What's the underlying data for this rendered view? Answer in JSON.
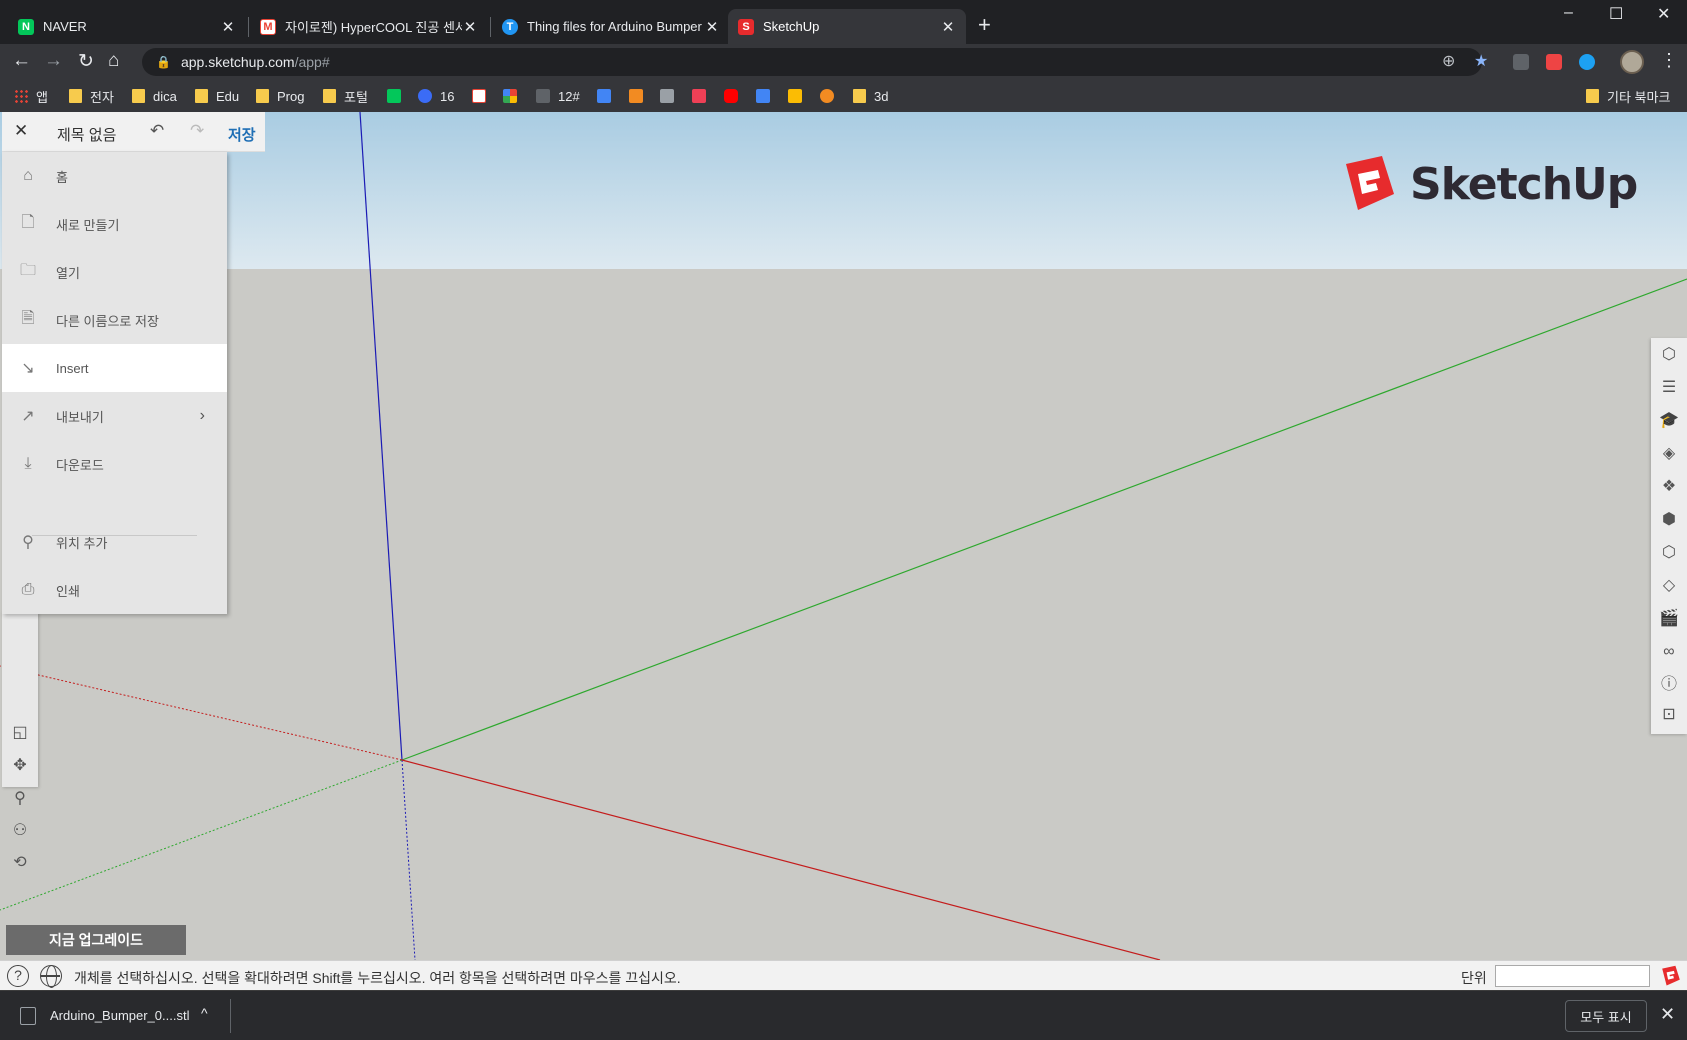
{
  "browser": {
    "tabs": [
      {
        "title": "NAVER",
        "icon": "naver-icon",
        "color": "#03c75a"
      },
      {
        "title": "자이로젠) HyperCOOL 진공 센서",
        "icon": "gmail-icon",
        "color": "#ea4335"
      },
      {
        "title": "Thing files for Arduino Bumper",
        "icon": "thingiverse-icon",
        "color": "#2196f3"
      },
      {
        "title": "SketchUp",
        "icon": "sketchup-icon",
        "color": "#e72b2d"
      }
    ],
    "new_tab": "+",
    "window_controls": {
      "minimize": "–",
      "maximize": "☐",
      "close": "✕"
    },
    "url": {
      "host": "app.sketchup.com",
      "path": "/app#"
    },
    "bookmarks": [
      {
        "label": "앱",
        "type": "apps"
      },
      {
        "label": "전자",
        "type": "folder"
      },
      {
        "label": "dica",
        "type": "folder"
      },
      {
        "label": "Edu",
        "type": "folder"
      },
      {
        "label": "Prog",
        "type": "folder"
      },
      {
        "label": "포털",
        "type": "folder"
      },
      {
        "label": "16",
        "type": "site"
      },
      {
        "label": "12#",
        "type": "site"
      },
      {
        "label": "3d",
        "type": "folder"
      }
    ],
    "other_bookmarks": "기타 북마크"
  },
  "app": {
    "header": {
      "close": "✕",
      "title": "제목 없음",
      "undo": "↶",
      "redo": "↷",
      "save": "저장"
    },
    "menu": {
      "items": [
        {
          "label": "홈",
          "icon": "home-icon"
        },
        {
          "label": "새로 만들기",
          "icon": "new-file-icon"
        },
        {
          "label": "열기",
          "icon": "folder-icon"
        },
        {
          "label": "다른 이름으로 저장",
          "icon": "save-as-icon"
        },
        {
          "label": "Insert",
          "icon": "insert-icon"
        },
        {
          "label": "내보내기",
          "icon": "export-icon"
        },
        {
          "label": "다운로드",
          "icon": "download-icon"
        },
        {
          "label": "위치 추가",
          "icon": "location-pin-icon"
        },
        {
          "label": "인쇄",
          "icon": "printer-icon"
        }
      ],
      "highlighted": "Insert"
    },
    "logo_text": "SketchUp",
    "upgrade_button": "지금 업그레이드",
    "status": {
      "message": "개체를 선택하십시오. 선택을 확대하려면 Shift를 누르십시오. 여러 항목을 선택하려면 마우스를 끄십시오.",
      "units_label": "단위",
      "units_value": ""
    },
    "colors": {
      "sky": "#b5d3e6",
      "ground": "#cacac6",
      "axis_blue": "#1b1bb5",
      "axis_green": "#2ea82e",
      "axis_red": "#c41c1c",
      "brand_red": "#e72b2d",
      "save_blue": "#1f6fb5"
    }
  },
  "downloads": {
    "file": "Arduino_Bumper_0....stl",
    "show_all": "모두 표시",
    "close": "✕"
  }
}
